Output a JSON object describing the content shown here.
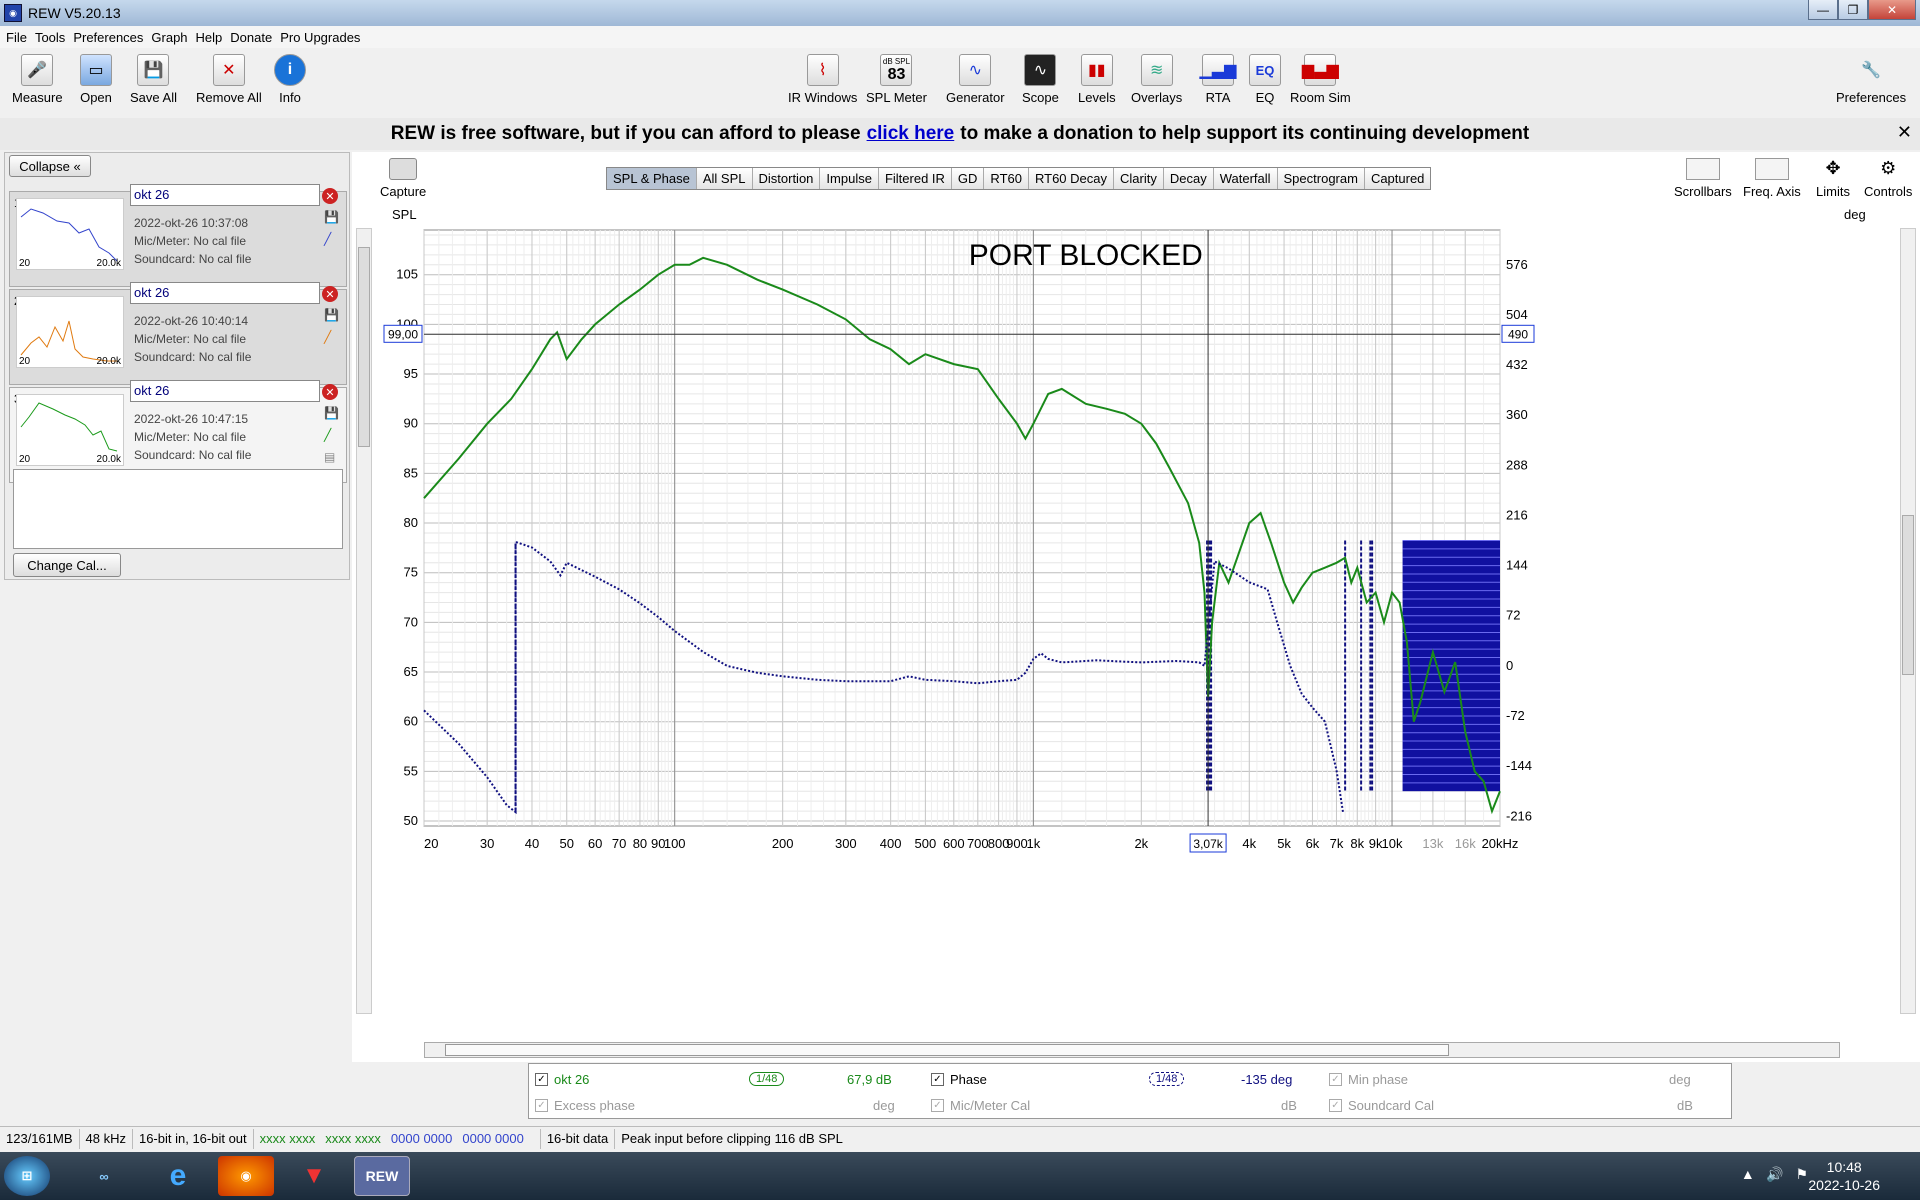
{
  "window": {
    "title": "REW V5.20.13"
  },
  "menu": [
    "File",
    "Tools",
    "Preferences",
    "Graph",
    "Help",
    "Donate",
    "Pro Upgrades"
  ],
  "toolbar": {
    "left": [
      "Measure",
      "Open",
      "Save All",
      "Remove All",
      "Info"
    ],
    "center": [
      "IR Windows",
      "SPL Meter",
      "Generator",
      "Scope",
      "Levels",
      "Overlays",
      "RTA",
      "EQ",
      "Room Sim"
    ],
    "spl_value": "83",
    "spl_unit": "dB SPL",
    "eq_glyph": "EQ",
    "right": "Preferences"
  },
  "banner": {
    "pre": "REW is free software, but if you can afford to please",
    "link": "click here",
    "post": "to make a donation to help support its continuing development"
  },
  "panel": {
    "collapse": "Collapse",
    "measurements": [
      {
        "num": "1",
        "name": "okt 26",
        "date": "2022-okt-26 10:37:08",
        "mic": "Mic/Meter: No cal file",
        "sound": "Soundcard: No cal file",
        "thumb_lo": "20",
        "thumb_hi": "20.0k",
        "color": "#3344cc"
      },
      {
        "num": "2",
        "name": "okt 26",
        "date": "2022-okt-26 10:40:14",
        "mic": "Mic/Meter: No cal file",
        "sound": "Soundcard: No cal file",
        "thumb_lo": "20",
        "thumb_hi": "20.0k",
        "color": "#e07a10"
      },
      {
        "num": "3",
        "name": "okt 26",
        "date": "2022-okt-26 10:47:15",
        "mic": "Mic/Meter: No cal file",
        "sound": "Soundcard: No cal file",
        "thumb_lo": "20",
        "thumb_hi": "20.0k",
        "color": "#1a9a1a"
      }
    ],
    "change_cal": "Change Cal..."
  },
  "graph": {
    "capture": "Capture",
    "tabs": [
      "SPL & Phase",
      "All SPL",
      "Distortion",
      "Impulse",
      "Filtered IR",
      "GD",
      "RT60",
      "RT60 Decay",
      "Clarity",
      "Decay",
      "Waterfall",
      "Spectrogram",
      "Captured"
    ],
    "active_tab": "SPL & Phase",
    "right_tools": [
      "Scrollbars",
      "Freq. Axis",
      "Limits",
      "Controls"
    ],
    "left_axis_label": "SPL",
    "right_axis_label": "deg",
    "annotation": "PORT BLOCKED",
    "cursor_spl": "99,00",
    "cursor_deg": "490",
    "cursor_freq": "3,07k"
  },
  "chart_data": {
    "type": "line",
    "xscale": "log",
    "xlim": [
      20,
      20000
    ],
    "ylim": [
      49.5,
      109.5
    ],
    "y2lim": [
      -230,
      626
    ],
    "y_ticks": [
      50,
      55,
      60,
      65,
      70,
      75,
      80,
      85,
      90,
      95,
      100,
      105
    ],
    "y2_ticks": [
      -216,
      -144,
      -72,
      0,
      72,
      144,
      216,
      288,
      360,
      432,
      504,
      576
    ],
    "x_ticks": [
      {
        "v": 20,
        "l": "20"
      },
      {
        "v": 30,
        "l": "30"
      },
      {
        "v": 40,
        "l": "40"
      },
      {
        "v": 50,
        "l": "50"
      },
      {
        "v": 60,
        "l": "60"
      },
      {
        "v": 70,
        "l": "70"
      },
      {
        "v": 80,
        "l": "80"
      },
      {
        "v": 90,
        "l": "90"
      },
      {
        "v": 100,
        "l": "100"
      },
      {
        "v": 200,
        "l": "200"
      },
      {
        "v": 300,
        "l": "300"
      },
      {
        "v": 400,
        "l": "400"
      },
      {
        "v": 500,
        "l": "500"
      },
      {
        "v": 600,
        "l": "600"
      },
      {
        "v": 700,
        "l": "700"
      },
      {
        "v": 800,
        "l": "800"
      },
      {
        "v": 900,
        "l": "900"
      },
      {
        "v": 1000,
        "l": "1k"
      },
      {
        "v": 2000,
        "l": "2k"
      },
      {
        "v": 4000,
        "l": "4k"
      },
      {
        "v": 5000,
        "l": "5k"
      },
      {
        "v": 6000,
        "l": "6k"
      },
      {
        "v": 7000,
        "l": "7k"
      },
      {
        "v": 8000,
        "l": "8k"
      },
      {
        "v": 9000,
        "l": "9k"
      },
      {
        "v": 10000,
        "l": "10k"
      },
      {
        "v": 13000,
        "l": "13k",
        "grey": true
      },
      {
        "v": 16000,
        "l": "16k",
        "grey": true
      },
      {
        "v": 20000,
        "l": "20kHz"
      }
    ],
    "cursor": {
      "x": 3070,
      "y": 99.0
    },
    "series": [
      {
        "name": "okt 26",
        "axis": "left",
        "color": "#1a8a1a",
        "points": [
          [
            20,
            82.5
          ],
          [
            25,
            86.5
          ],
          [
            30,
            90
          ],
          [
            35,
            92.5
          ],
          [
            40,
            95.5
          ],
          [
            45,
            98.5
          ],
          [
            47,
            99.2
          ],
          [
            50,
            96.5
          ],
          [
            55,
            98.5
          ],
          [
            60,
            100
          ],
          [
            70,
            102
          ],
          [
            80,
            103.5
          ],
          [
            90,
            105
          ],
          [
            100,
            106
          ],
          [
            110,
            106
          ],
          [
            120,
            106.7
          ],
          [
            140,
            106
          ],
          [
            170,
            104.5
          ],
          [
            200,
            103.5
          ],
          [
            250,
            102
          ],
          [
            300,
            100.5
          ],
          [
            350,
            98.5
          ],
          [
            400,
            97.5
          ],
          [
            450,
            96
          ],
          [
            500,
            97
          ],
          [
            600,
            96
          ],
          [
            700,
            95.5
          ],
          [
            800,
            92.5
          ],
          [
            900,
            90
          ],
          [
            950,
            88.5
          ],
          [
            1000,
            90
          ],
          [
            1100,
            93
          ],
          [
            1200,
            93.5
          ],
          [
            1400,
            92
          ],
          [
            1600,
            91.5
          ],
          [
            1800,
            91
          ],
          [
            2000,
            90
          ],
          [
            2200,
            88
          ],
          [
            2400,
            85.5
          ],
          [
            2700,
            82
          ],
          [
            2900,
            78
          ],
          [
            3000,
            73
          ],
          [
            3070,
            62.5
          ],
          [
            3150,
            70
          ],
          [
            3300,
            76
          ],
          [
            3500,
            74
          ],
          [
            3700,
            76.5
          ],
          [
            4000,
            80
          ],
          [
            4300,
            81
          ],
          [
            4600,
            78
          ],
          [
            5000,
            74
          ],
          [
            5300,
            72
          ],
          [
            5600,
            73.5
          ],
          [
            6000,
            75
          ],
          [
            6500,
            75.5
          ],
          [
            7000,
            76
          ],
          [
            7400,
            76.5
          ],
          [
            7700,
            74
          ],
          [
            8000,
            75.5
          ],
          [
            8500,
            72
          ],
          [
            9000,
            73
          ],
          [
            9500,
            70
          ],
          [
            10000,
            73
          ],
          [
            10500,
            72
          ],
          [
            11000,
            68
          ],
          [
            11500,
            60
          ],
          [
            12000,
            62
          ],
          [
            13000,
            67
          ],
          [
            14000,
            63
          ],
          [
            15000,
            66
          ],
          [
            16000,
            59
          ],
          [
            17000,
            55
          ],
          [
            18000,
            54
          ],
          [
            19000,
            51
          ],
          [
            20000,
            53
          ]
        ]
      },
      {
        "name": "Phase",
        "axis": "right",
        "color": "#101080",
        "points": [
          [
            20,
            -64
          ],
          [
            25,
            -112
          ],
          [
            30,
            -160
          ],
          [
            34,
            -200
          ],
          [
            36,
            -210
          ],
          [
            36,
            178
          ],
          [
            40,
            170
          ],
          [
            45,
            150
          ],
          [
            48,
            130
          ],
          [
            50,
            148
          ],
          [
            60,
            128
          ],
          [
            70,
            110
          ],
          [
            80,
            90
          ],
          [
            90,
            70
          ],
          [
            100,
            50
          ],
          [
            120,
            20
          ],
          [
            140,
            0
          ],
          [
            170,
            -10
          ],
          [
            200,
            -15
          ],
          [
            250,
            -20
          ],
          [
            300,
            -22
          ],
          [
            400,
            -22
          ],
          [
            450,
            -15
          ],
          [
            500,
            -20
          ],
          [
            600,
            -22
          ],
          [
            700,
            -25
          ],
          [
            800,
            -22
          ],
          [
            900,
            -20
          ],
          [
            950,
            -10
          ],
          [
            1000,
            10
          ],
          [
            1050,
            18
          ],
          [
            1100,
            10
          ],
          [
            1200,
            5
          ],
          [
            1500,
            8
          ],
          [
            1800,
            6
          ],
          [
            2000,
            5
          ],
          [
            2500,
            7
          ],
          [
            2900,
            5
          ],
          [
            3000,
            0
          ],
          [
            3200,
            150
          ],
          [
            3500,
            140
          ],
          [
            4000,
            120
          ],
          [
            4500,
            110
          ],
          [
            4800,
            60
          ],
          [
            5200,
            0
          ],
          [
            5600,
            -40
          ],
          [
            6000,
            -60
          ],
          [
            6500,
            -80
          ],
          [
            7000,
            -150
          ],
          [
            7300,
            -210
          ]
        ]
      }
    ],
    "noise_lines": [
      3050,
      3080,
      3100,
      3130,
      7400,
      8200,
      8700,
      8800
    ],
    "noise_band": [
      10700,
      20000
    ]
  },
  "legend": {
    "items": [
      {
        "label": "okt 26",
        "value": "67,9 dB",
        "smooth": "1/48",
        "color": "#1a8a1a",
        "enabled": true
      },
      {
        "label": "Phase",
        "value": "-135 deg",
        "smooth": "1/48",
        "color": "#101080",
        "enabled": true
      },
      {
        "label": "Min phase",
        "value": "deg",
        "enabled": false
      },
      {
        "label": "Excess phase",
        "value": "deg",
        "enabled": false
      },
      {
        "label": "Mic/Meter Cal",
        "value": "dB",
        "enabled": false
      },
      {
        "label": "Soundcard Cal",
        "value": "dB",
        "enabled": false
      }
    ]
  },
  "status": {
    "memory": "123/161MB",
    "rate": "48 kHz",
    "bits": "16-bit in, 16-bit out",
    "lights_green": [
      "xxxx xxxx",
      "xxxx xxxx"
    ],
    "lights_blue": [
      "0000 0000",
      "0000 0000"
    ],
    "data": "16-bit data",
    "peak": "Peak input before clipping 116 dB SPL"
  },
  "taskbar": {
    "rew_label": "REW",
    "time": "10:48",
    "date": "2022-10-26"
  }
}
